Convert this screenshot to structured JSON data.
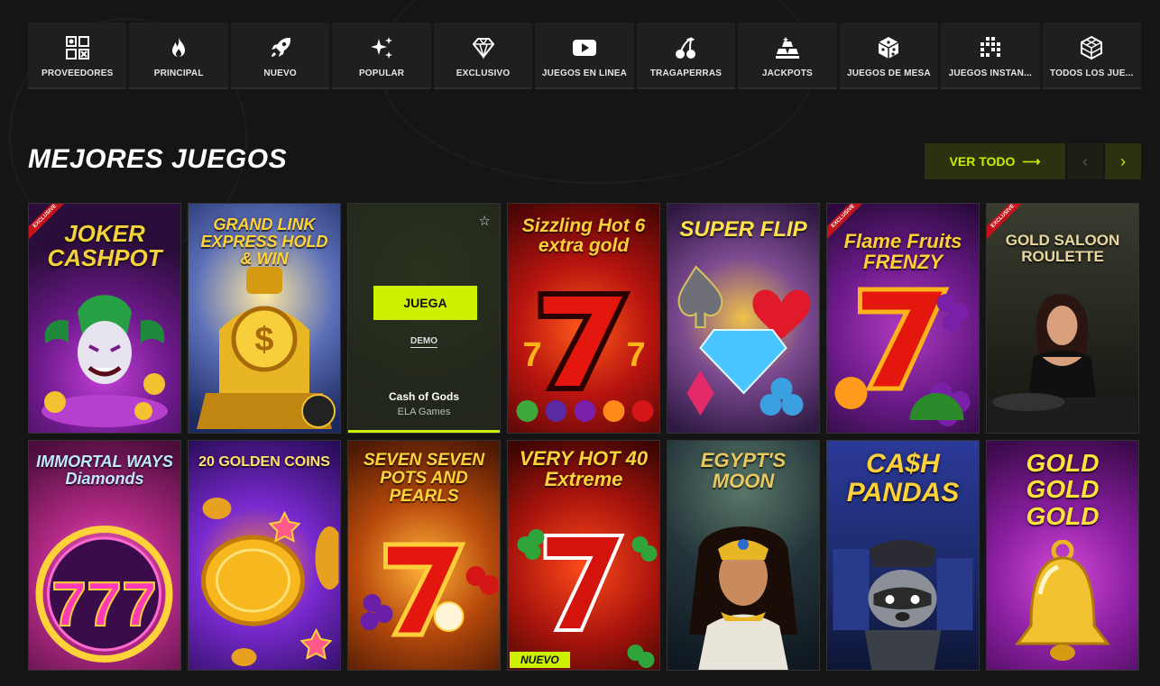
{
  "categories": [
    {
      "label": "PROVEEDORES",
      "icon": "providers-grid-icon"
    },
    {
      "label": "PRINCIPAL",
      "icon": "flame-icon"
    },
    {
      "label": "NUEVO",
      "icon": "rocket-icon"
    },
    {
      "label": "POPULAR",
      "icon": "sparkles-icon"
    },
    {
      "label": "EXCLUSIVO",
      "icon": "diamond-icon"
    },
    {
      "label": "JUEGOS EN LÍNEA",
      "icon": "play-icon"
    },
    {
      "label": "TRAGAPERRAS",
      "icon": "cherries-icon"
    },
    {
      "label": "JACKPOTS",
      "icon": "gold-bars-icon"
    },
    {
      "label": "JUEGOS DE MESA",
      "icon": "dice-icon"
    },
    {
      "label": "JUEGOS INSTAN...",
      "icon": "pixel-blocks-icon"
    },
    {
      "label": "TODOS LOS JUE...",
      "icon": "cube-icon"
    }
  ],
  "section": {
    "title": "MEJORES JUEGOS",
    "view_all": "VER TODO",
    "view_all_arrow": "⟶",
    "prev": "‹",
    "next": "›"
  },
  "games": [
    {
      "title": "JOKER CASHPOT",
      "ribbon": "EXCLUSIVE",
      "art": "joker-art"
    },
    {
      "title": "GRAND LINK EXPRESS HOLD & WIN",
      "art": "train-art"
    },
    {
      "hover": true,
      "button": "JUEGA",
      "demo": "DEMO",
      "name": "Cash of Gods",
      "provider": "ELA Games",
      "star": "☆"
    },
    {
      "title": "Sizzling Hot 6 extra gold",
      "art": "seven-art"
    },
    {
      "title": "SUPER FLIP",
      "art": "gem-suits-art"
    },
    {
      "title": "Flame Fruits FRENZY",
      "ribbon": "EXCLUSIVE",
      "art": "fruit-seven-art"
    },
    {
      "title": "GOLD SALOON ROULETTE",
      "ribbon": "EXCLUSIVE",
      "art": "dealer-art"
    },
    {
      "title": "IMMORTAL WAYS Diamonds",
      "art": "wheel-777-art"
    },
    {
      "title": "20 GOLDEN COINS",
      "art": "coin-art"
    },
    {
      "title": "SEVEN SEVEN POTS AND PEARLS",
      "art": "seven-pearls-art"
    },
    {
      "title": "VERY HOT 40 Extreme",
      "badge": "NUEVO",
      "art": "red-seven-art"
    },
    {
      "title": "EGYPT'S MOON",
      "art": "queen-art"
    },
    {
      "title": "CA$H PANDAS",
      "art": "raccoon-art"
    },
    {
      "title": "GOLD GOLD GOLD",
      "art": "bell-art"
    }
  ]
}
